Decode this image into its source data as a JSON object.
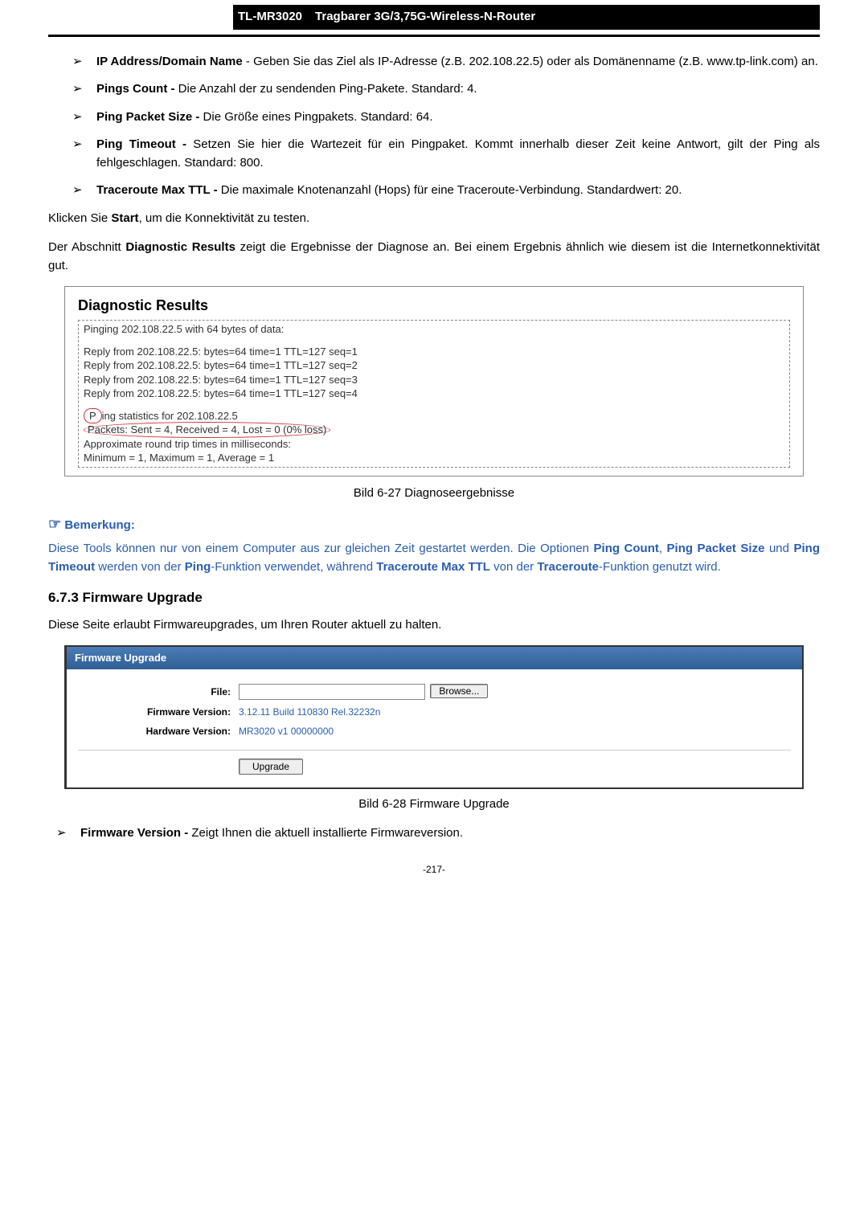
{
  "header": {
    "model": "TL-MR3020",
    "title": "Tragbarer 3G/3,75G-Wireless-N-Router"
  },
  "bullets1": [
    {
      "term": "IP Address/Domain Name",
      "text": " - Geben Sie das Ziel als IP-Adresse (z.B. 202.108.22.5) oder als Domänenname (z.B. www.tp-link.com) an."
    },
    {
      "term": "Pings Count -",
      "text": " Die Anzahl der zu sendenden Ping-Pakete. Standard: 4."
    },
    {
      "term": "Ping Packet Size -",
      "text": " Die Größe eines Pingpakets. Standard: 64."
    },
    {
      "term": "Ping Timeout -",
      "text": " Setzen Sie hier die Wartezeit für ein Pingpaket. Kommt innerhalb dieser Zeit keine Antwort, gilt der Ping als fehlgeschlagen. Standard: 800."
    },
    {
      "term": "Traceroute Max TTL -",
      "text": " Die maximale Knotenanzahl (Hops) für eine Traceroute-Verbindung. Standardwert: 20."
    }
  ],
  "p_click_start_pre": "Klicken Sie ",
  "p_click_start_bold": "Start",
  "p_click_start_post": ", um die Konnektivität zu testen.",
  "p_diag_pre": "Der Abschnitt ",
  "p_diag_bold": "Diagnostic Results",
  "p_diag_post": " zeigt die Ergebnisse der Diagnose an. Bei einem Ergebnis ähnlich wie diesem ist die Internetkonnektivität gut.",
  "diag": {
    "title": "Diagnostic Results",
    "l0": "Pinging 202.108.22.5 with 64 bytes of data:",
    "r1": "Reply from 202.108.22.5:  bytes=64  time=1  TTL=127  seq=1",
    "r2": "Reply from 202.108.22.5:  bytes=64  time=1  TTL=127  seq=2",
    "r3": "Reply from 202.108.22.5:  bytes=64  time=1  TTL=127  seq=3",
    "r4": "Reply from 202.108.22.5:  bytes=64  time=1  TTL=127  seq=4",
    "s1a": "P",
    "s1b": "ing statistics for 202.108.22.5",
    "s2a": "P",
    "s2b": "ackets: Sent = 4, Received = 4, Lost = 0 (0% loss)",
    "s3": "Approximate round trip times in milliseconds:",
    "s4": "Minimum = 1, Maximum = 1, Average = 1"
  },
  "caption1": "Bild 6-27 Diagnoseergebnisse",
  "note_label": "Bemerkung:",
  "note_body_1": "Diese Tools können nur von einem Computer aus zur gleichen Zeit gestartet werden. Die Optionen ",
  "note_b1": "Ping Count",
  "note_sep1": ", ",
  "note_b2": "Ping Packet Size",
  "note_sep2": " und ",
  "note_b3": "Ping Timeout",
  "note_mid": " werden von der ",
  "note_b4": "Ping",
  "note_mid2": "-Funktion verwendet, während ",
  "note_b5": "Traceroute Max TTL",
  "note_mid3": " von der ",
  "note_b6": "Traceroute",
  "note_end": "-Funktion genutzt wird.",
  "sec673": "6.7.3    Firmware Upgrade",
  "p_fw_intro": "Diese Seite erlaubt Firmwareupgrades, um Ihren Router aktuell zu halten.",
  "fw": {
    "title": "Firmware Upgrade",
    "file_label": "File:",
    "browse": "Browse...",
    "fv_label": "Firmware Version:",
    "fv_value": "3.12.11 Build 110830 Rel.32232n",
    "hv_label": "Hardware Version:",
    "hv_value": "MR3020 v1 00000000",
    "upgrade": "Upgrade"
  },
  "caption2": "Bild 6-28 Firmware Upgrade",
  "bullet_fw_term": "Firmware Version -",
  "bullet_fw_text": " Zeigt Ihnen die aktuell installierte Firmwareversion.",
  "pagenum": "-217-"
}
